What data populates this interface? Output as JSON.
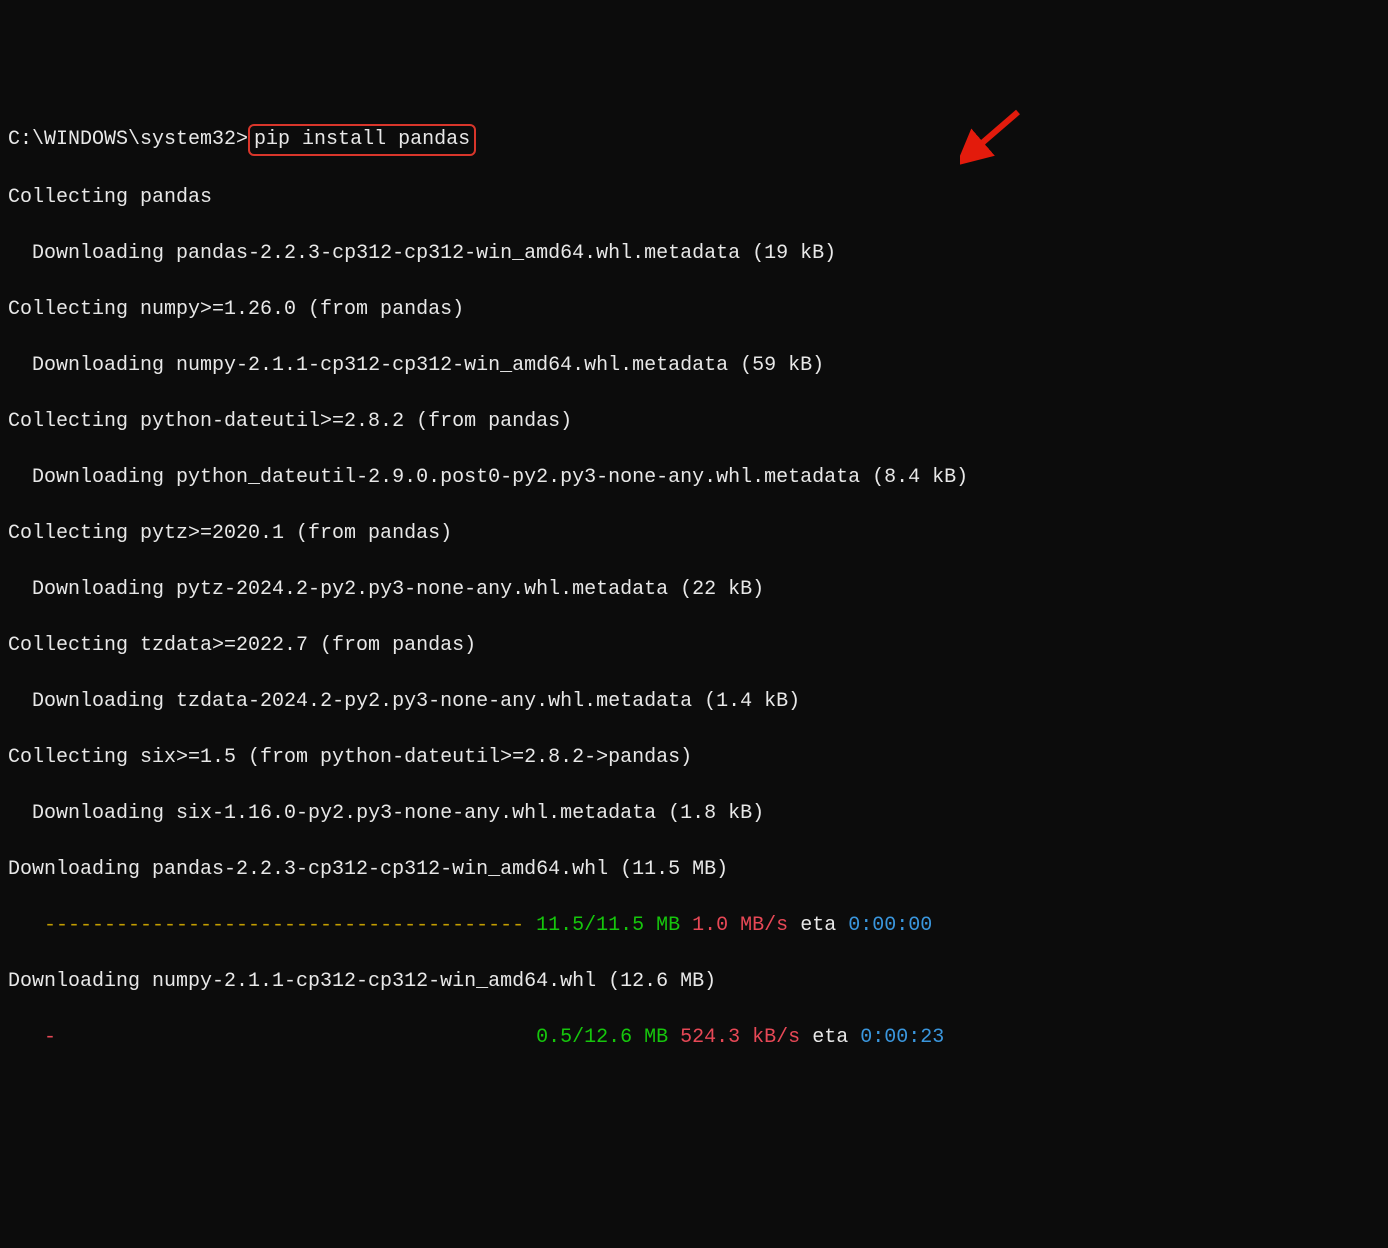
{
  "prompt": "C:\\WINDOWS\\system32>",
  "command": "pip install pandas",
  "lines": {
    "collecting_pandas": "Collecting pandas",
    "dl_pandas_meta": "Downloading pandas-2.2.3-cp312-cp312-win_amd64.whl.metadata (19 kB)",
    "collecting_numpy": "Collecting numpy>=1.26.0 (from pandas)",
    "dl_numpy_meta": "Downloading numpy-2.1.1-cp312-cp312-win_amd64.whl.metadata (59 kB)",
    "collecting_dateutil": "Collecting python-dateutil>=2.8.2 (from pandas)",
    "dl_dateutil_meta": "Downloading python_dateutil-2.9.0.post0-py2.py3-none-any.whl.metadata (8.4 kB)",
    "collecting_pytz": "Collecting pytz>=2020.1 (from pandas)",
    "dl_pytz_meta": "Downloading pytz-2024.2-py2.py3-none-any.whl.metadata (22 kB)",
    "collecting_tzdata": "Collecting tzdata>=2022.7 (from pandas)",
    "dl_tzdata_meta": "Downloading tzdata-2024.2-py2.py3-none-any.whl.metadata (1.4 kB)",
    "collecting_six": "Collecting six>=1.5 (from python-dateutil>=2.8.2->pandas)",
    "dl_six_meta": "Downloading six-1.16.0-py2.py3-none-any.whl.metadata (1.8 kB)",
    "dl_pandas_full": "Downloading pandas-2.2.3-cp312-cp312-win_amd64.whl (11.5 MB)",
    "dl_numpy_full": "Downloading numpy-2.1.1-cp312-cp312-win_amd64.whl (12.6 MB)"
  },
  "progress_pandas": {
    "bar": "----------------------------------------",
    "done_total": "11.5/11.5 MB",
    "speed": "1.0 MB/s",
    "eta_label": "eta",
    "eta": "0:00:00"
  },
  "progress_numpy": {
    "bar": "-",
    "done_total": "0.5/12.6 MB",
    "speed": "524.3 kB/s",
    "eta_label": "eta",
    "eta": "0:00:23"
  },
  "colors": {
    "arrow": "#e31b0c"
  }
}
